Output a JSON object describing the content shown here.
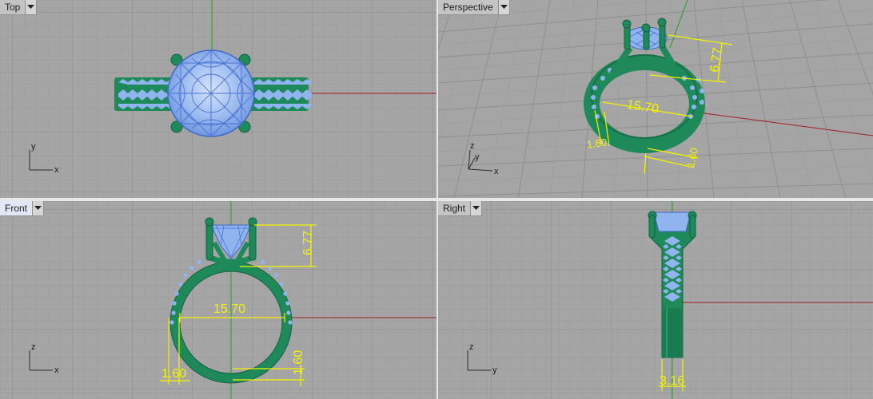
{
  "viewports": {
    "top": {
      "label": "Top",
      "axis_a": "y",
      "axis_b": "x"
    },
    "persp": {
      "label": "Perspective",
      "axis_a": "y",
      "axis_b": "x",
      "axis_c": "z"
    },
    "front": {
      "label": "Front",
      "axis_a": "z",
      "axis_b": "x"
    },
    "right": {
      "label": "Right",
      "axis_a": "z",
      "axis_b": "y"
    }
  },
  "dimensions": {
    "height": "6.77",
    "inner_diameter": "15.70",
    "band_thickness": "1.60",
    "band_thickness_b": "1.60",
    "band_width": "3.16"
  },
  "colors": {
    "viewport_bg": "#a5a5a5",
    "grid_minor": "#9c9c9c",
    "grid_major": "#8a8a8a",
    "ring_green": "#1e8a5a",
    "stone_blue": "#8fb4ee",
    "dimension_yellow": "#f4f400",
    "axis_red": "#a02020",
    "axis_green": "#1fa01f"
  },
  "icons": {
    "dropdown": "caret-down-icon",
    "axis": "axis-triad-icon"
  }
}
